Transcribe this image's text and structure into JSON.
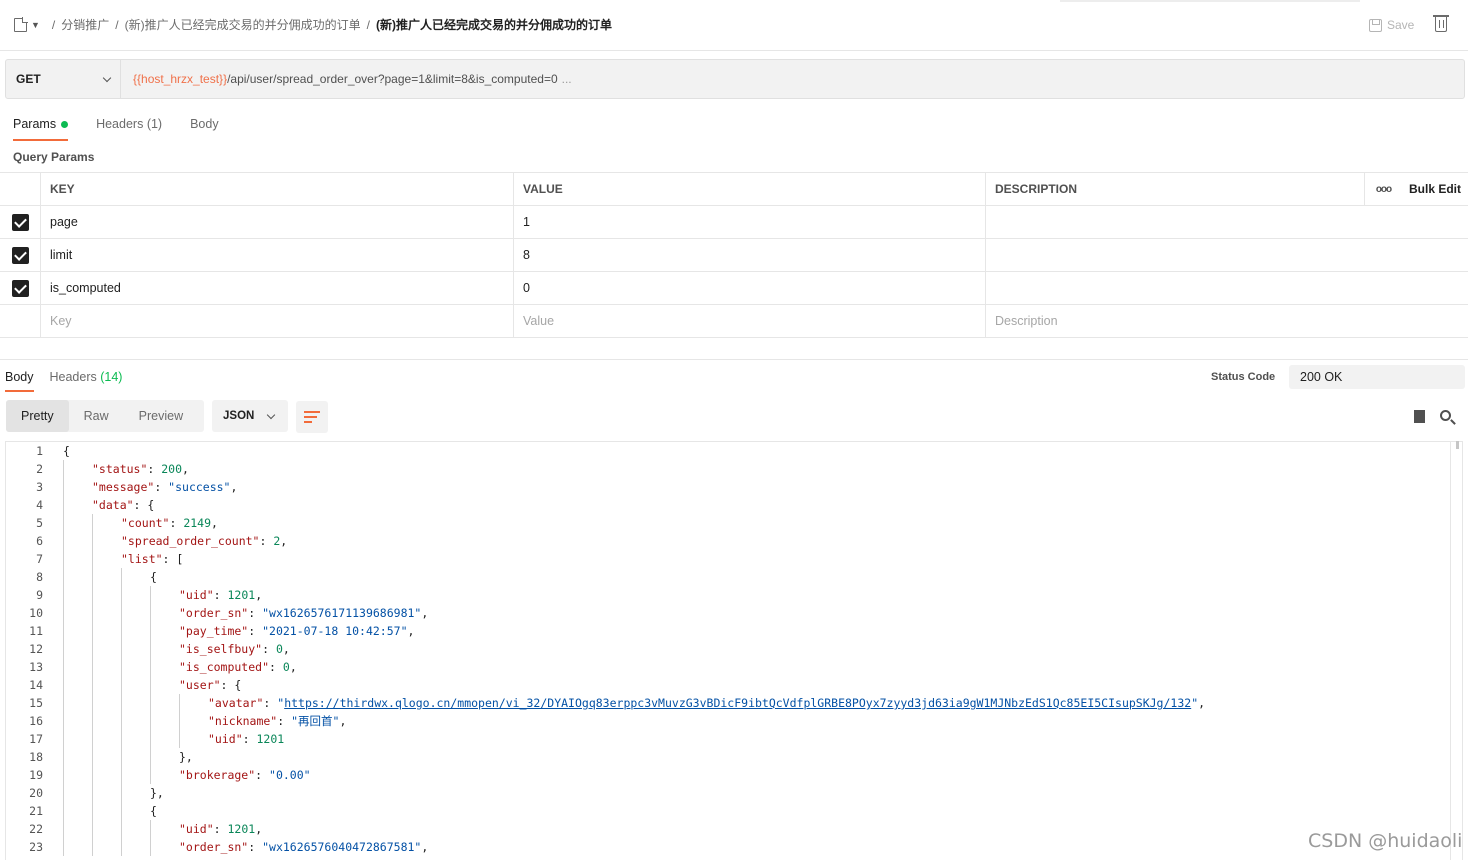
{
  "breadcrumb": {
    "items": [
      "分销推广",
      "(新)推广人已经完成交易的并分佣成功的订单"
    ],
    "current": "(新)推广人已经完成交易的并分佣成功的订单",
    "separator": "/"
  },
  "toolbar": {
    "save_label": "Save"
  },
  "request": {
    "method": "GET",
    "url_var": "{{host_hrzx_test}}",
    "url_path": "/api/user/spread_order_over?page=1&limit=8&is_computed=0",
    "url_ellipsis": "..."
  },
  "request_tabs": {
    "params": "Params",
    "headers": "Headers",
    "headers_count": "(1)",
    "body": "Body"
  },
  "query_params": {
    "label": "Query Params",
    "headers": {
      "key": "KEY",
      "value": "VALUE",
      "description": "DESCRIPTION",
      "more": "ooo",
      "bulk_edit": "Bulk Edit"
    },
    "rows": [
      {
        "key": "page",
        "value": "1",
        "checked": true
      },
      {
        "key": "limit",
        "value": "8",
        "checked": true
      },
      {
        "key": "is_computed",
        "value": "0",
        "checked": true
      }
    ],
    "placeholders": {
      "key": "Key",
      "value": "Value",
      "description": "Description"
    }
  },
  "response": {
    "tabs": {
      "body": "Body",
      "headers": "Headers",
      "headers_count": "(14)"
    },
    "status_label": "Status Code",
    "status_value": "200 OK",
    "views": [
      "Pretty",
      "Raw",
      "Preview"
    ],
    "format": "JSON"
  },
  "code_lines": [
    {
      "n": "1",
      "indent": 0,
      "parts": [
        [
          "p",
          "{"
        ]
      ]
    },
    {
      "n": "2",
      "indent": 1,
      "parts": [
        [
          "k",
          "\"status\""
        ],
        [
          "p",
          ": "
        ],
        [
          "n",
          "200"
        ],
        [
          "p",
          ","
        ]
      ]
    },
    {
      "n": "3",
      "indent": 1,
      "parts": [
        [
          "k",
          "\"message\""
        ],
        [
          "p",
          ": "
        ],
        [
          "s",
          "\"success\""
        ],
        [
          "p",
          ","
        ]
      ]
    },
    {
      "n": "4",
      "indent": 1,
      "parts": [
        [
          "k",
          "\"data\""
        ],
        [
          "p",
          ": {"
        ]
      ]
    },
    {
      "n": "5",
      "indent": 2,
      "parts": [
        [
          "k",
          "\"count\""
        ],
        [
          "p",
          ": "
        ],
        [
          "n",
          "2149"
        ],
        [
          "p",
          ","
        ]
      ]
    },
    {
      "n": "6",
      "indent": 2,
      "parts": [
        [
          "k",
          "\"spread_order_count\""
        ],
        [
          "p",
          ": "
        ],
        [
          "n",
          "2"
        ],
        [
          "p",
          ","
        ]
      ]
    },
    {
      "n": "7",
      "indent": 2,
      "parts": [
        [
          "k",
          "\"list\""
        ],
        [
          "p",
          ": ["
        ]
      ]
    },
    {
      "n": "8",
      "indent": 3,
      "parts": [
        [
          "p",
          "{"
        ]
      ]
    },
    {
      "n": "9",
      "indent": 4,
      "parts": [
        [
          "k",
          "\"uid\""
        ],
        [
          "p",
          ": "
        ],
        [
          "n",
          "1201"
        ],
        [
          "p",
          ","
        ]
      ]
    },
    {
      "n": "10",
      "indent": 4,
      "parts": [
        [
          "k",
          "\"order_sn\""
        ],
        [
          "p",
          ": "
        ],
        [
          "s",
          "\"wx1626576171139686981\""
        ],
        [
          "p",
          ","
        ]
      ]
    },
    {
      "n": "11",
      "indent": 4,
      "parts": [
        [
          "k",
          "\"pay_time\""
        ],
        [
          "p",
          ": "
        ],
        [
          "s",
          "\"2021-07-18 10:42:57\""
        ],
        [
          "p",
          ","
        ]
      ]
    },
    {
      "n": "12",
      "indent": 4,
      "parts": [
        [
          "k",
          "\"is_selfbuy\""
        ],
        [
          "p",
          ": "
        ],
        [
          "n",
          "0"
        ],
        [
          "p",
          ","
        ]
      ]
    },
    {
      "n": "13",
      "indent": 4,
      "parts": [
        [
          "k",
          "\"is_computed\""
        ],
        [
          "p",
          ": "
        ],
        [
          "n",
          "0"
        ],
        [
          "p",
          ","
        ]
      ]
    },
    {
      "n": "14",
      "indent": 4,
      "parts": [
        [
          "k",
          "\"user\""
        ],
        [
          "p",
          ": {"
        ]
      ]
    },
    {
      "n": "15",
      "indent": 5,
      "parts": [
        [
          "k",
          "\"avatar\""
        ],
        [
          "p",
          ": "
        ],
        [
          "s",
          "\""
        ],
        [
          "l",
          "https://thirdwx.qlogo.cn/mmopen/vi_32/DYAIOgq83erppc3vMuvzG3vBDicF9ibtQcVdfplGRBE8POyx7zyyd3jd63ia9gW1MJNbzEdS1Qc85EI5CIsupSKJg/132"
        ],
        [
          "s",
          "\""
        ],
        [
          "p",
          ","
        ]
      ]
    },
    {
      "n": "16",
      "indent": 5,
      "parts": [
        [
          "k",
          "\"nickname\""
        ],
        [
          "p",
          ": "
        ],
        [
          "s",
          "\"再回首\""
        ],
        [
          "p",
          ","
        ]
      ]
    },
    {
      "n": "17",
      "indent": 5,
      "parts": [
        [
          "k",
          "\"uid\""
        ],
        [
          "p",
          ": "
        ],
        [
          "n",
          "1201"
        ]
      ]
    },
    {
      "n": "18",
      "indent": 4,
      "parts": [
        [
          "p",
          "},"
        ]
      ]
    },
    {
      "n": "19",
      "indent": 4,
      "parts": [
        [
          "k",
          "\"brokerage\""
        ],
        [
          "p",
          ": "
        ],
        [
          "s",
          "\"0.00\""
        ]
      ]
    },
    {
      "n": "20",
      "indent": 3,
      "parts": [
        [
          "p",
          "},"
        ]
      ]
    },
    {
      "n": "21",
      "indent": 3,
      "parts": [
        [
          "p",
          "{"
        ]
      ]
    },
    {
      "n": "22",
      "indent": 4,
      "parts": [
        [
          "k",
          "\"uid\""
        ],
        [
          "p",
          ": "
        ],
        [
          "n",
          "1201"
        ],
        [
          "p",
          ","
        ]
      ]
    },
    {
      "n": "23",
      "indent": 4,
      "parts": [
        [
          "k",
          "\"order_sn\""
        ],
        [
          "p",
          ": "
        ],
        [
          "s",
          "\"wx1626576040472867581\""
        ],
        [
          "p",
          ","
        ]
      ]
    }
  ],
  "watermark": "CSDN @huidaoli",
  "colors": {
    "accent": "#f26b3a",
    "success": "#0cbb52",
    "url_var": "#f0714a"
  }
}
